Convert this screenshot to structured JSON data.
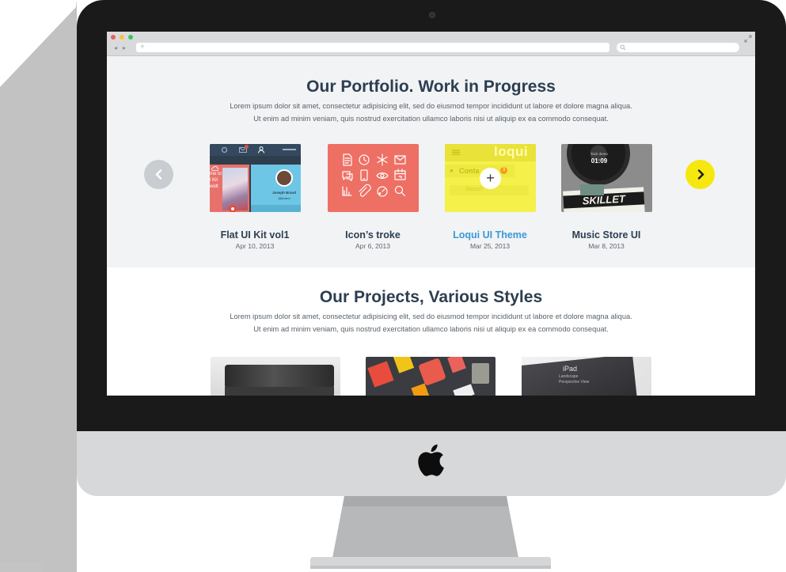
{
  "browser": {
    "back_icon": "back-arrow-icon",
    "forward_icon": "forward-arrow-icon",
    "new_tab_symbol": "+",
    "traffic_light_colors": [
      "#ee5f5b",
      "#f9c23c",
      "#35c759"
    ]
  },
  "portfolio": {
    "title": "Our Portfolio. Work in Progress",
    "description_line1": "Lorem ipsum dolor sit amet, consectetur adipisicing elit, sed do eiusmod tempor incididunt ut labore et dolore magna aliqua.",
    "description_line2": "Ut enim ad minim veniam, quis nostrud exercitation ullamco laboris nisi ut aliquip ex ea commodo consequat.",
    "items": [
      {
        "title": "Flat UI Kit vol1",
        "date": "Apr 10, 2013",
        "profile_name": "Joseph Brand",
        "profile_sub": "@jbrand",
        "side_text": "me to\nl Kit\nwidt"
      },
      {
        "title": "Icon’s troke",
        "date": "Apr 6, 2013"
      },
      {
        "title": "Loqui UI Theme",
        "date": "Mar 25, 2013",
        "brand": "loqui",
        "tab_label": "Conta",
        "search_placeholder": "Search",
        "badge_count": "3",
        "overlay_symbol": "+"
      },
      {
        "title": "Music Store UI",
        "date": "Mar 8, 2013",
        "track_label": "Tack demo",
        "track_time": "01:09",
        "album_text": "SKILLET"
      }
    ],
    "active_title_color": "#3a99d8",
    "next_button_color": "#f6e70f",
    "prev_button_color": "#c9cdd1"
  },
  "projects": {
    "title": "Our Projects, Various Styles",
    "description_line1": "Lorem ipsum dolor sit amet, consectetur adipisicing elit, sed do eiusmod tempor incididunt ut labore et dolore magna aliqua.",
    "description_line2": "Ut enim ad minim veniam, quis nostrud exercitation ullamco laboris nisi ut aliquip ex ea commodo consequat.",
    "thumbs": [
      {
        "name": "coffee-cup-mockup"
      },
      {
        "name": "flat-icons-set"
      },
      {
        "name": "ipad-mockup",
        "device_label": "iPad",
        "sub1": "Landscape",
        "sub2": "Perspective View"
      }
    ]
  }
}
